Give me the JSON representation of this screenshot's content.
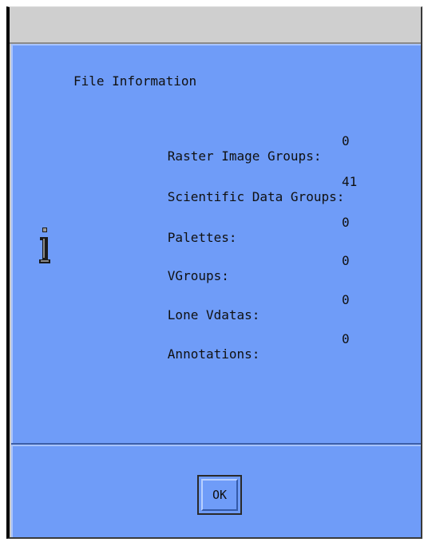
{
  "dialog": {
    "heading": "File Information",
    "icon": "info-icon",
    "rows": [
      {
        "label": "Raster Image Groups:",
        "value": "0"
      },
      {
        "label": "Scientific Data Groups:",
        "value": "41"
      },
      {
        "label": "Palettes:",
        "value": "0"
      },
      {
        "label": "VGroups:",
        "value": "0"
      },
      {
        "label": "Lone Vdatas:",
        "value": "0"
      },
      {
        "label": "Annotations:",
        "value": "0"
      }
    ],
    "ok_label": "OK"
  },
  "colors": {
    "dialog_background": "#6f9cf8",
    "title_bar": "#cfcfcf"
  }
}
